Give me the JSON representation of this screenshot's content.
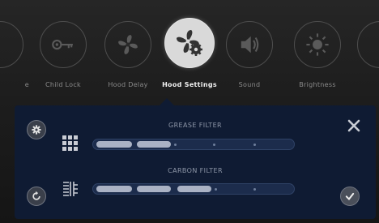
{
  "menu": {
    "items": [
      {
        "label": "e",
        "icon": "partial-icon"
      },
      {
        "label": "Child Lock",
        "icon": "key-icon"
      },
      {
        "label": "Hood Delay",
        "icon": "fan-icon"
      },
      {
        "label": "Hood Settings",
        "icon": "fan-gear-icon",
        "active": true
      },
      {
        "label": "Sound",
        "icon": "speaker-icon"
      },
      {
        "label": "Brightness",
        "icon": "sun-icon"
      },
      {
        "label": "",
        "icon": "partial-icon"
      }
    ]
  },
  "panel": {
    "grease_filter": {
      "title": "GREASE FILTER",
      "level_segments": 2,
      "total_segments": 5
    },
    "carbon_filter": {
      "title": "CARBON FILTER",
      "level_segments": 3,
      "total_segments": 5
    }
  },
  "colors": {
    "panel_bg": "#0f1b33",
    "track_fill": "#aab2c4",
    "active_circle": "#d9d9d9"
  }
}
